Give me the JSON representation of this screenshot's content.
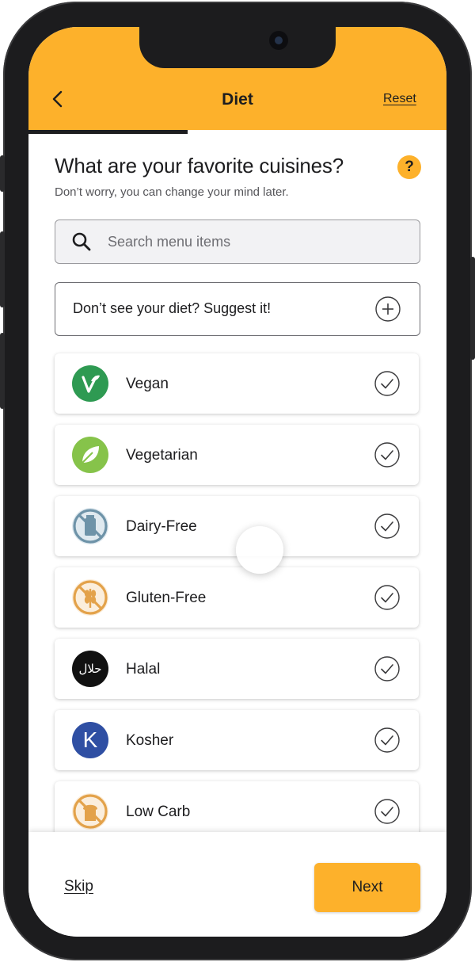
{
  "header": {
    "title": "Diet",
    "reset_label": "Reset",
    "progress": 0.38,
    "accent": "#fdb12b"
  },
  "question": {
    "title": "What are your favorite cuisines?",
    "subtitle": "Don’t worry, you can change your mind later.",
    "help_label": "?"
  },
  "search": {
    "placeholder": "Search menu items",
    "value": ""
  },
  "suggest": {
    "label": "Don’t see your diet? Suggest it!"
  },
  "diets": [
    {
      "label": "Vegan",
      "icon": "vegan-icon",
      "color": "#2e9a52"
    },
    {
      "label": "Vegetarian",
      "icon": "leaf-icon",
      "color": "#86c34a"
    },
    {
      "label": "Dairy-Free",
      "icon": "dairy-free-icon",
      "color": "#6e93a8"
    },
    {
      "label": "Gluten-Free",
      "icon": "gluten-free-icon",
      "color": "#e3a24a"
    },
    {
      "label": "Halal",
      "icon": "halal-icon",
      "color": "#111111",
      "icon_text": "حلال"
    },
    {
      "label": "Kosher",
      "icon": "kosher-icon",
      "color": "#2f4fa3",
      "icon_text": "K"
    },
    {
      "label": "Low Carb",
      "icon": "low-carb-icon",
      "color": "#e3a24a"
    }
  ],
  "footer": {
    "skip_label": "Skip",
    "next_label": "Next"
  }
}
